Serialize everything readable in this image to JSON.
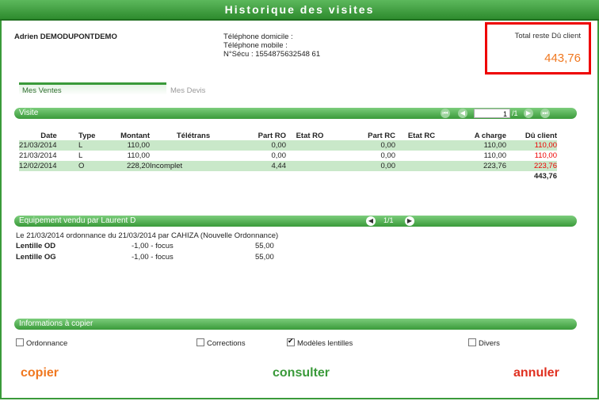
{
  "window": {
    "title": "Historique des visites"
  },
  "patient": {
    "name": "Adrien DEMODUPONTDEMO",
    "phone_home_label": "Téléphone domicile :",
    "phone_mobile_label": "Téléphone mobile :",
    "secu": "N°Sécu : 1554875632548 61"
  },
  "total": {
    "label": "Total reste Dû client",
    "value": "443,76",
    "value_color": "#f07820"
  },
  "tabs": {
    "active": "Mes Ventes",
    "inactive": "Mes Devis"
  },
  "visite_section": {
    "title": "Visite",
    "page_value": "1",
    "page_total": "/1",
    "columns": [
      "Date",
      "Type",
      "Montant",
      "Télétrans",
      "Part RO",
      "Etat RO",
      "Part RC",
      "Etat RC",
      "A charge",
      "Dû client"
    ],
    "rows": [
      {
        "date": "21/03/2014",
        "type": "L",
        "montant": "110,00",
        "teletrans": "",
        "part_ro": "0,00",
        "etat_ro": "",
        "part_rc": "0,00",
        "etat_rc": "",
        "a_charge": "110,00",
        "du_client": "110,00"
      },
      {
        "date": "21/03/2014",
        "type": "L",
        "montant": "110,00",
        "teletrans": "",
        "part_ro": "0,00",
        "etat_ro": "",
        "part_rc": "0,00",
        "etat_rc": "",
        "a_charge": "110,00",
        "du_client": "110,00"
      },
      {
        "date": "12/02/2014",
        "type": "O",
        "montant": "228,20",
        "teletrans": "Incomplet",
        "part_ro": "4,44",
        "etat_ro": "",
        "part_rc": "0,00",
        "etat_rc": "",
        "a_charge": "223,76",
        "du_client": "223,76"
      }
    ],
    "total_du": "443,76"
  },
  "equipement_section": {
    "title": "Equipement vendu par Laurent D",
    "pager": "1/1",
    "ordonnance_line": "Le 21/03/2014 ordonnance du 21/03/2014 par CAHIZA (Nouvelle Ordonnance)",
    "lenses": [
      {
        "label": "Lentille OD",
        "correction": "-1,00 - focus",
        "price": "55,00"
      },
      {
        "label": "Lentille OG",
        "correction": "-1,00 - focus",
        "price": "55,00"
      }
    ]
  },
  "copy_section": {
    "title": "Informations à copier",
    "options": [
      {
        "label": "Ordonnance",
        "checked": false
      },
      {
        "label": "Corrections",
        "checked": false
      },
      {
        "label": "Modèles lentilles",
        "checked": true
      },
      {
        "label": "Divers",
        "checked": false
      }
    ]
  },
  "actions": {
    "copier": "copier",
    "consulter": "consulter",
    "annuler": "annuler",
    "copier_color": "#f07820",
    "consulter_color": "#3a9a3a",
    "annuler_color": "#e03020"
  },
  "icons": {
    "pager_first": "first-page-icon",
    "pager_prev": "prev-page-icon",
    "pager_next": "next-page-icon",
    "pager_last": "last-page-icon"
  }
}
